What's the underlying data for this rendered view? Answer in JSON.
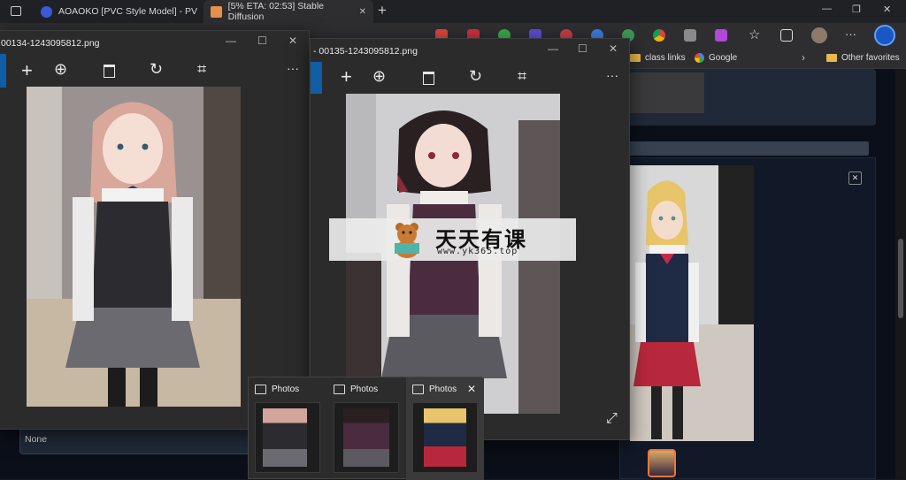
{
  "browser": {
    "tabs": [
      {
        "label": "AOAOKO [PVC Style Model] - PV",
        "close": "✕"
      },
      {
        "label": "[5% ETA: 02:53] Stable Diffusion",
        "close": "✕"
      }
    ],
    "new_tab": "+",
    "favorites": [
      {
        "label": "class links"
      },
      {
        "label": "Google"
      },
      {
        "label": "Other favorites"
      }
    ],
    "more": "···"
  },
  "photos_window_1": {
    "title": "00134-1243095812.png",
    "more": "···"
  },
  "photos_window_2": {
    "title": "- 00135-1243095812.png",
    "more": "···"
  },
  "previews": [
    {
      "label": "Photos"
    },
    {
      "label": "Photos"
    },
    {
      "label": "Photos",
      "close": "✕"
    }
  ],
  "webpage": {
    "dropdown_value": "None",
    "close": "✕"
  },
  "watermark": {
    "title": "天天有课",
    "url": "www.yk365.top"
  },
  "colors": {
    "accent": "#0e5ea8",
    "page_bg": "#0b0f19",
    "photos_bg": "#2b2b2b"
  }
}
